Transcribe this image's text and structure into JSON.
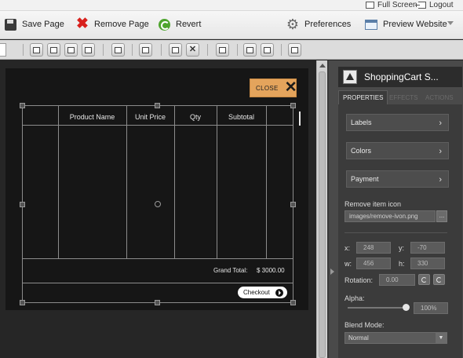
{
  "topbar": {
    "fullscreen_label": "Full Screen",
    "logout_label": "Logout"
  },
  "toolbar": {
    "save_label": "Save Page",
    "remove_label": "Remove Page",
    "revert_label": "Revert",
    "preferences_label": "Preferences",
    "preview_label": "Preview Website"
  },
  "canvas": {
    "close_label": "CLOSE",
    "cart": {
      "headers": [
        "Product Name",
        "Unit Price",
        "Qty",
        "Subtotal"
      ],
      "grand_total_label": "Grand Total:",
      "grand_total_value": "$ 3000.00",
      "checkout_label": "Checkout"
    }
  },
  "panel": {
    "title": "ShoppingCart S...",
    "tabs": [
      "PROPERTIES",
      "EFFECTS",
      "ACTIONS"
    ],
    "sections": [
      "Labels",
      "Colors",
      "Payment"
    ],
    "remove_icon_label": "Remove item icon",
    "remove_icon_value": "images/remove-ivon.png",
    "browse_label": "...",
    "x_label": "x:",
    "x_value": "248",
    "y_label": "y:",
    "y_value": "-70",
    "w_label": "w:",
    "w_value": "456",
    "h_label": "h:",
    "h_value": "330",
    "rotation_label": "Rotation:",
    "rotation_value": "0.00",
    "alpha_label": "Alpha:",
    "alpha_value": "100%",
    "alpha_level": 1.0,
    "blend_label": "Blend Mode:",
    "blend_value": "Normal"
  },
  "colors": {
    "close_button": "#e4a45c",
    "panel_bg": "#4a4a4a",
    "stage_bg": "#161616"
  }
}
